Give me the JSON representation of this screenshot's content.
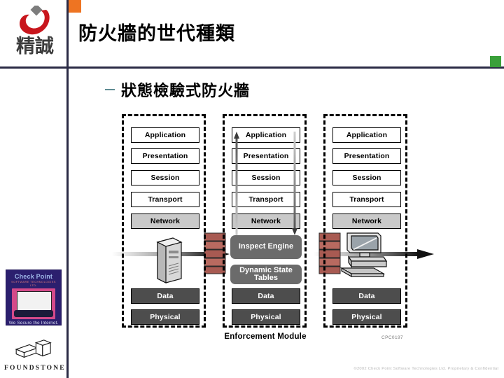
{
  "slide": {
    "title": "防火牆的世代種類",
    "subtitle": "狀態檢驗式防火牆",
    "bullet_dash": "–"
  },
  "brand": {
    "systex_cn": "精誠",
    "checkpoint_name": "Check Point",
    "checkpoint_subline": "SOFTWARE TECHNOLOGIES LTD.",
    "checkpoint_tagline": "We Secure the Internet.",
    "foundstone_name": "FOUNDSTONE"
  },
  "colors": {
    "divider": "#2b2b45",
    "orange_square": "#ee7422",
    "green_square": "#3aa03a",
    "layer_white": "#ffffff",
    "layer_gray": "#c9c9c9",
    "layer_dark": "#4d4d4d",
    "pill_gray": "#6b6b6b",
    "dash_teal": "#5f8c93",
    "checkpoint_navy": "#2b1f6e",
    "checkpoint_magenta": "#d44a8a"
  },
  "diagram": {
    "stacks": [
      {
        "id": "left",
        "upper_layers": [
          {
            "label": "Application",
            "style": "white"
          },
          {
            "label": "Presentation",
            "style": "white"
          },
          {
            "label": "Session",
            "style": "white"
          },
          {
            "label": "Transport",
            "style": "white"
          },
          {
            "label": "Network",
            "style": "gray"
          }
        ],
        "lower_layers": [
          {
            "label": "Data",
            "style": "dark"
          },
          {
            "label": "Physical",
            "style": "dark"
          }
        ],
        "device": "server-tower-icon"
      },
      {
        "id": "middle",
        "upper_layers": [
          {
            "label": "Application",
            "style": "white"
          },
          {
            "label": "Presentation",
            "style": "white"
          },
          {
            "label": "Session",
            "style": "white"
          },
          {
            "label": "Transport",
            "style": "white"
          },
          {
            "label": "Network",
            "style": "gray"
          }
        ],
        "lower_layers": [
          {
            "label": "Data",
            "style": "dark"
          },
          {
            "label": "Physical",
            "style": "dark"
          }
        ],
        "inspect_engine": "Inspect Engine",
        "dynamic_state_tables": "Dynamic State Tables",
        "caption": "Enforcement Module"
      },
      {
        "id": "right",
        "upper_layers": [
          {
            "label": "Application",
            "style": "white"
          },
          {
            "label": "Presentation",
            "style": "white"
          },
          {
            "label": "Session",
            "style": "white"
          },
          {
            "label": "Transport",
            "style": "white"
          },
          {
            "label": "Network",
            "style": "gray"
          }
        ],
        "lower_layers": [
          {
            "label": "Data",
            "style": "dark"
          },
          {
            "label": "Physical",
            "style": "dark"
          }
        ],
        "device": "desktop-computer-icon"
      }
    ],
    "image_code": "CPC0197"
  },
  "footer": {
    "copyright": "©2002 Check Point Software Technologies Ltd.  Proprietary & Confidential"
  }
}
